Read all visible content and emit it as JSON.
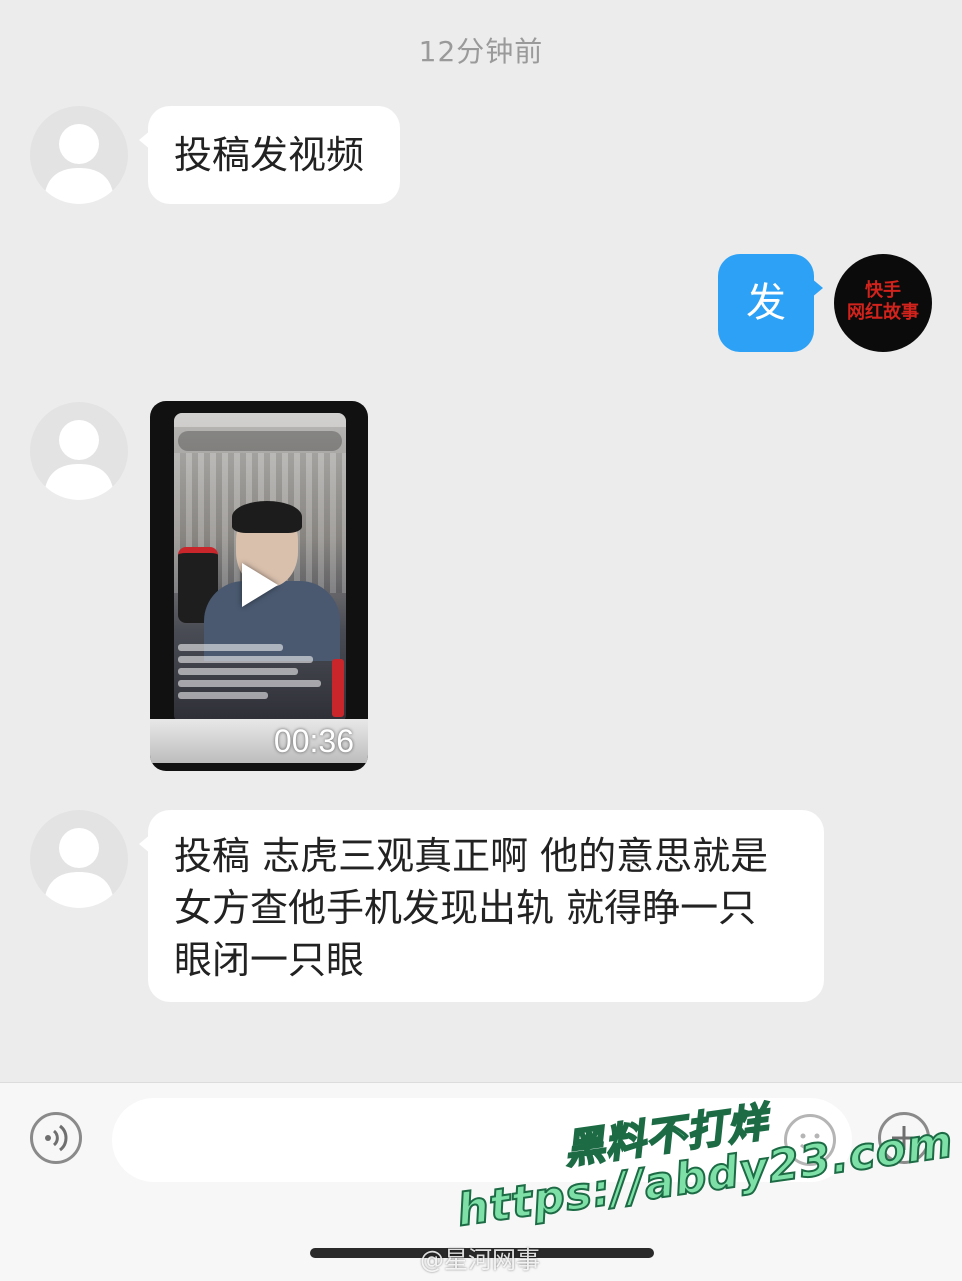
{
  "timestamp": "12分钟前",
  "messages": [
    {
      "sender": "other",
      "type": "text",
      "lines": [
        "投稿发视频"
      ]
    },
    {
      "sender": "self",
      "type": "text",
      "lines": [
        "发"
      ],
      "avatar_text": [
        "快手",
        "网红故事"
      ]
    },
    {
      "sender": "other",
      "type": "video",
      "duration": "00:36"
    },
    {
      "sender": "other",
      "type": "text",
      "lines": [
        "投稿 志虎三观真正啊 他的意思就是",
        "女方查他手机发现出轨 就得睁一只",
        "眼闭一只眼"
      ]
    }
  ],
  "input_bar": {
    "voice_icon": "voice-icon",
    "emoji_icon": "emoji-icon",
    "plus_icon": "plus-icon",
    "text_value": ""
  },
  "watermarks": {
    "line1": "黑料不打烊",
    "line2": "https://abdy23.com",
    "weibo": "@星河网事"
  },
  "colors": {
    "background": "#ececec",
    "outgoing_bubble": "#2da1f5",
    "incoming_bubble": "#ffffff",
    "timestamp": "#9a9a9a"
  }
}
